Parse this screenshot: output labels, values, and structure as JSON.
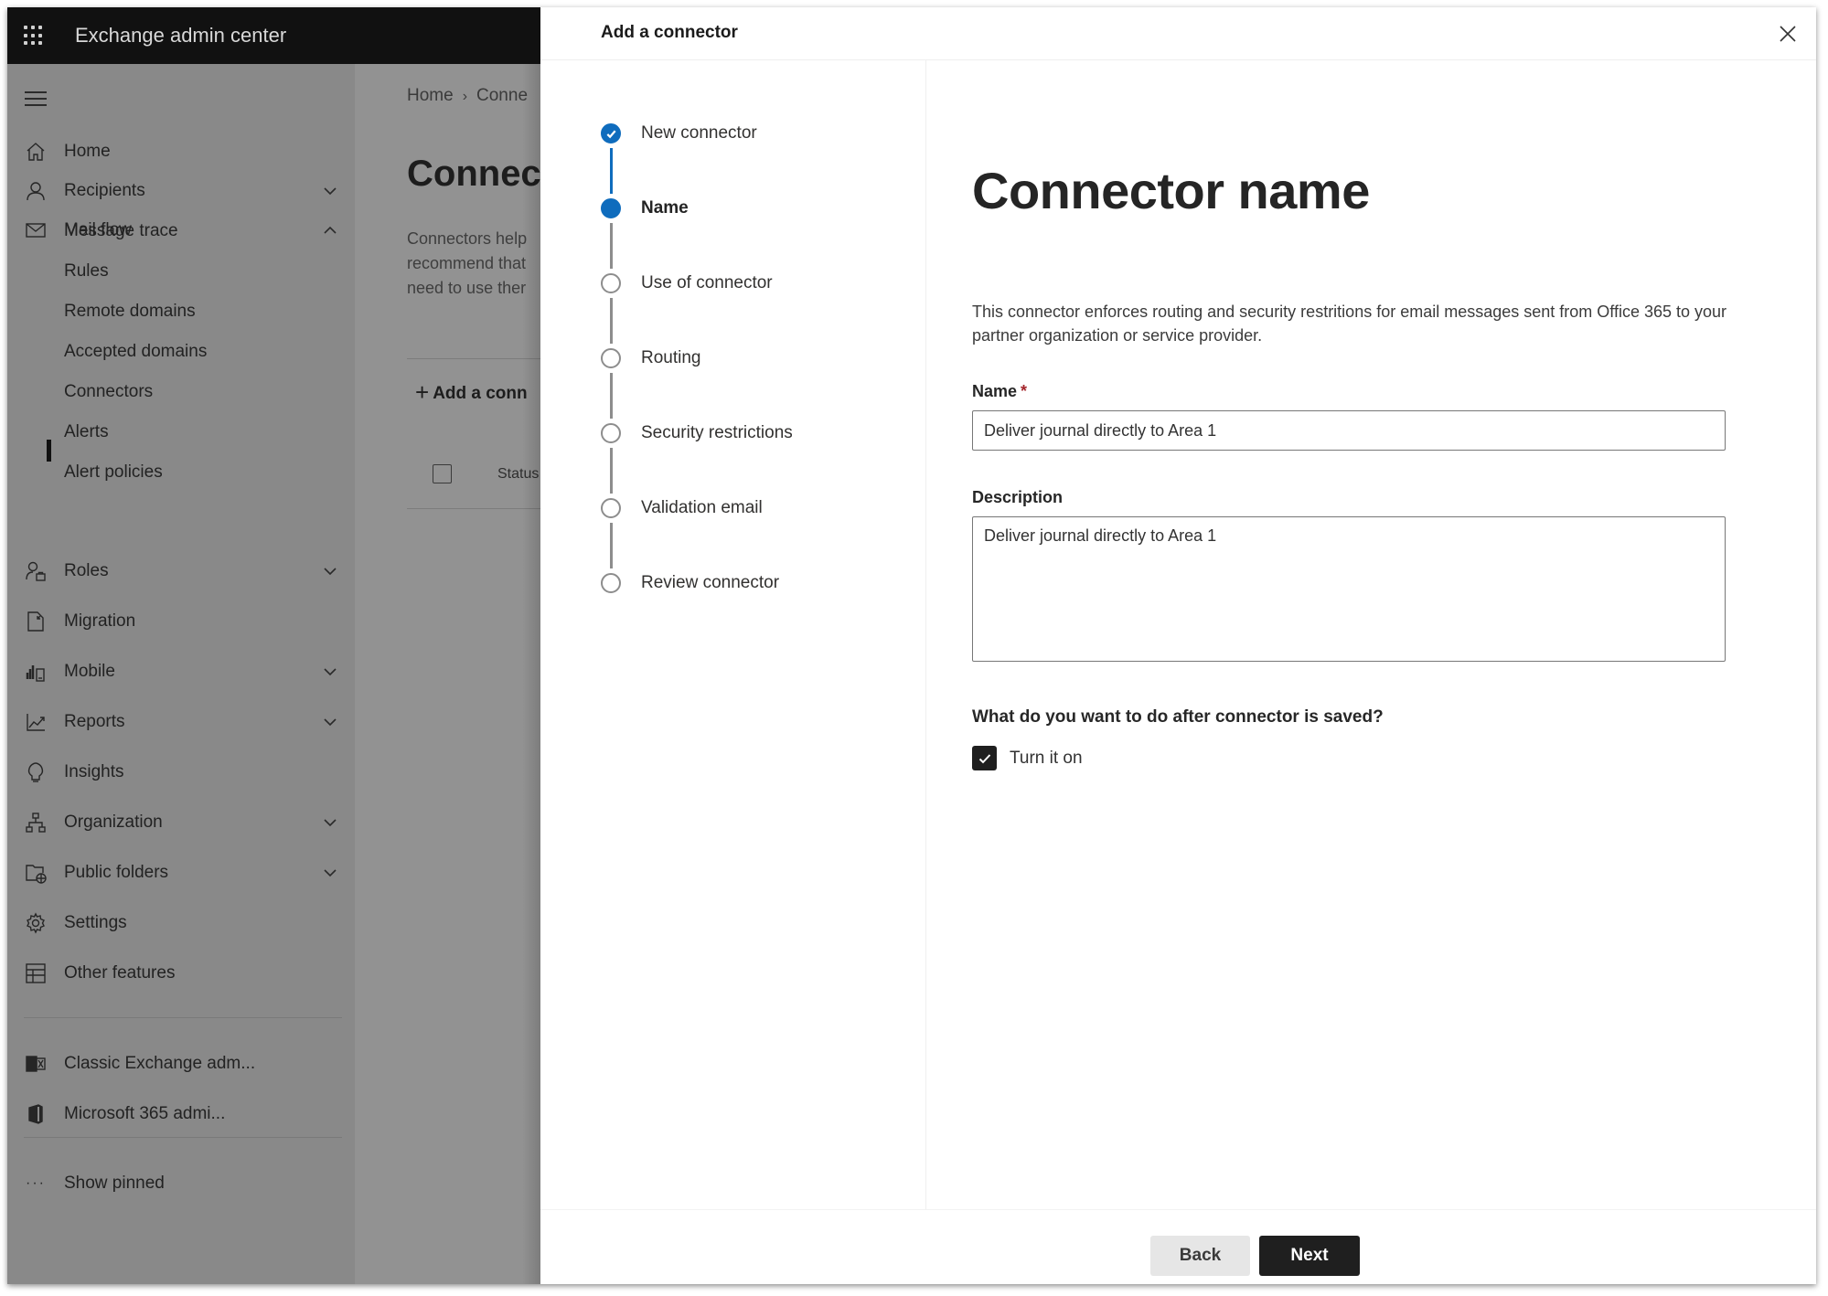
{
  "app": {
    "title": "Exchange admin center"
  },
  "sidebar": {
    "items": [
      {
        "label": "Home",
        "icon": "home-icon",
        "has_chevron": false
      },
      {
        "label": "Recipients",
        "icon": "person-icon",
        "has_chevron": true,
        "expanded": false
      },
      {
        "label": "Mail flow",
        "icon": "mail-icon",
        "has_chevron": true,
        "expanded": true
      },
      {
        "label": "Roles",
        "icon": "roles-icon",
        "has_chevron": true,
        "expanded": false
      },
      {
        "label": "Migration",
        "icon": "migration-icon",
        "has_chevron": false
      },
      {
        "label": "Mobile",
        "icon": "mobile-icon",
        "has_chevron": true,
        "expanded": false
      },
      {
        "label": "Reports",
        "icon": "reports-chart-icon",
        "has_chevron": true,
        "expanded": false
      },
      {
        "label": "Insights",
        "icon": "lightbulb-icon",
        "has_chevron": false
      },
      {
        "label": "Organization",
        "icon": "org-chart-icon",
        "has_chevron": true,
        "expanded": false
      },
      {
        "label": "Public folders",
        "icon": "public-folder-icon",
        "has_chevron": true,
        "expanded": false
      },
      {
        "label": "Settings",
        "icon": "gear-icon",
        "has_chevron": false
      },
      {
        "label": "Other features",
        "icon": "grid-table-icon",
        "has_chevron": false
      }
    ],
    "mail_flow_subitems": [
      {
        "label": "Message trace",
        "active": false
      },
      {
        "label": "Rules",
        "active": false
      },
      {
        "label": "Remote domains",
        "active": false
      },
      {
        "label": "Accepted domains",
        "active": false
      },
      {
        "label": "Connectors",
        "active": true
      },
      {
        "label": "Alerts",
        "active": false
      },
      {
        "label": "Alert policies",
        "active": false
      }
    ],
    "external_links": [
      {
        "label": "Classic Exchange adm...",
        "icon": "exchange-logo-icon"
      },
      {
        "label": "Microsoft 365 admi...",
        "icon": "office-logo-icon"
      }
    ],
    "show_pinned": "Show pinned"
  },
  "main": {
    "breadcrumb": [
      "Home",
      "Conne"
    ],
    "title": "Connec",
    "description_lines": [
      "Connectors help",
      "recommend that",
      "need to use ther"
    ],
    "add_button": "Add a conn",
    "table_header_status": "Status"
  },
  "panel": {
    "title": "Add a connector",
    "steps": [
      {
        "label": "New connector",
        "state": "done"
      },
      {
        "label": "Name",
        "state": "current"
      },
      {
        "label": "Use of connector",
        "state": "pending"
      },
      {
        "label": "Routing",
        "state": "pending"
      },
      {
        "label": "Security restrictions",
        "state": "pending"
      },
      {
        "label": "Validation email",
        "state": "pending"
      },
      {
        "label": "Review connector",
        "state": "pending"
      }
    ],
    "content": {
      "heading": "Connector name",
      "description": "This connector enforces routing and security restritions for email messages sent from Office 365 to your partner organization or service provider.",
      "name_label": "Name",
      "name_required_mark": "*",
      "name_value": "Deliver journal directly to Area 1",
      "description_label": "Description",
      "description_value": "Deliver journal directly to Area 1",
      "question": "What do you want to do after connector is saved?",
      "turn_on_label": "Turn it on",
      "turn_on_checked": true
    },
    "footer": {
      "back_label": "Back",
      "next_label": "Next"
    }
  },
  "colors": {
    "accent_blue": "#0f6cbd",
    "topbar": "#111111",
    "primary_button": "#1f1f1f",
    "required": "#a4262c"
  }
}
